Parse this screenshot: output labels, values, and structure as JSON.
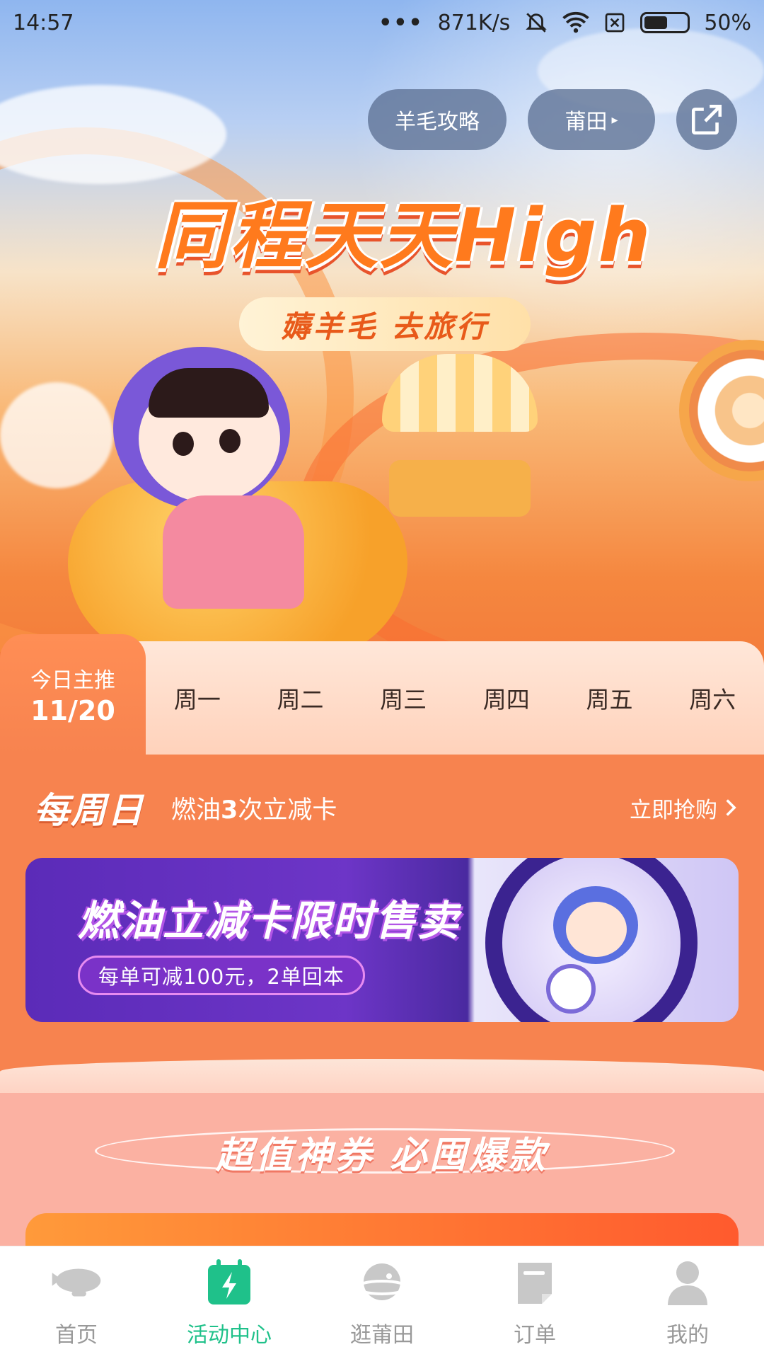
{
  "status_bar": {
    "time": "14:57",
    "dots": "•••",
    "speed": "871K/s",
    "battery": "50%"
  },
  "header": {
    "guide_label": "羊毛攻略",
    "city_label": "莆田",
    "city_arrow": "▸",
    "icons": [
      "mute-icon",
      "wifi-icon",
      "sim-icon",
      "battery-icon",
      "share-icon"
    ]
  },
  "banner": {
    "title": "同程天天High",
    "subtitle": "薅羊毛 去旅行"
  },
  "day_tabs": {
    "today_label": "今日主推",
    "today_date": "11/20",
    "days": [
      "周一",
      "周二",
      "周三",
      "周四",
      "周五",
      "周六"
    ]
  },
  "promo": {
    "weekday": "每周日",
    "desc_pre": "燃油",
    "desc_num": "3",
    "desc_post": "次立减卡",
    "buy_label": "立即抢购",
    "card_title": "燃油立减卡限时售卖",
    "card_sub": "每单可减100元，2单回本"
  },
  "coupons": {
    "title": "超值神券 必囤爆款"
  },
  "tabbar": {
    "items": [
      {
        "label": "首页",
        "icon": "airship-icon",
        "active": false
      },
      {
        "label": "活动中心",
        "icon": "calendar-bolt-icon",
        "active": true
      },
      {
        "label": "逛莆田",
        "icon": "planet-icon",
        "active": false
      },
      {
        "label": "订单",
        "icon": "document-icon",
        "active": false
      },
      {
        "label": "我的",
        "icon": "user-icon",
        "active": false
      }
    ]
  },
  "colors": {
    "accent_green": "#1fc18a",
    "promo_orange": "#f7834f",
    "inactive_gray": "#999999"
  }
}
